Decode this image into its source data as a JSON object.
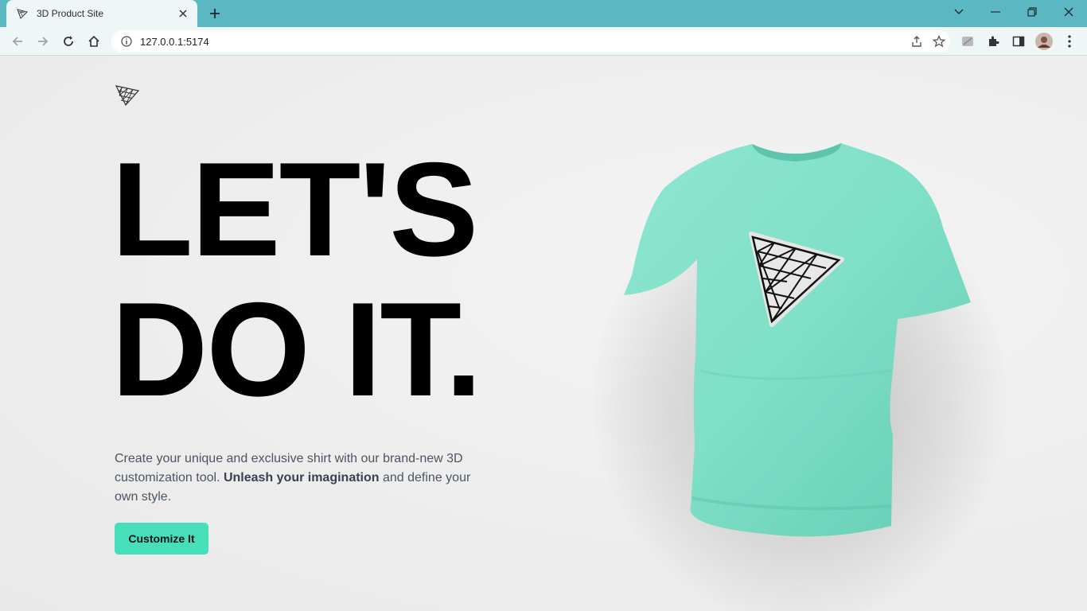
{
  "browser": {
    "tab_title": "3D Product Site",
    "url": "127.0.0.1:5174"
  },
  "hero": {
    "headline_line1": "LET'S",
    "headline_line2": "DO IT.",
    "desc_part1": "Create your unique and exclusive shirt with our brand-new 3D customization tool. ",
    "desc_bold": "Unleash your imagination",
    "desc_part2": " and define your own style.",
    "cta_label": "Customize It"
  },
  "colors": {
    "accent": "#46dfb9",
    "shirt": "#7fe0c8",
    "chrome": "#5bb8c2"
  },
  "icons": [
    "back-icon",
    "forward-icon",
    "reload-icon",
    "home-icon",
    "info-icon",
    "share-icon",
    "star-icon",
    "extensions-icon",
    "sidepanel-icon",
    "menu-icon"
  ]
}
